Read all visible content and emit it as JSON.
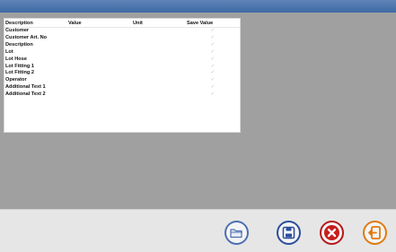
{
  "table": {
    "headers": {
      "description": "Description",
      "value": "Value",
      "unit": "Unit",
      "save_value": "Save Value"
    },
    "rows": [
      {
        "description": "Customer",
        "value": "",
        "unit": "",
        "save_value": "✓"
      },
      {
        "description": "Customer Art. No",
        "value": "",
        "unit": "",
        "save_value": "✓"
      },
      {
        "description": "Description",
        "value": "",
        "unit": "",
        "save_value": "✓"
      },
      {
        "description": "Lot",
        "value": "",
        "unit": "",
        "save_value": "✓"
      },
      {
        "description": "Lot Hose",
        "value": "",
        "unit": "",
        "save_value": "✓"
      },
      {
        "description": "Lot Fitting 1",
        "value": "",
        "unit": "",
        "save_value": "✓"
      },
      {
        "description": "Lot Fitting 2",
        "value": "",
        "unit": "",
        "save_value": "✓"
      },
      {
        "description": "Operator",
        "value": "",
        "unit": "",
        "save_value": "✓"
      },
      {
        "description": "Additional Text 1",
        "value": "",
        "unit": "",
        "save_value": "✓"
      },
      {
        "description": "Additional Text 2",
        "value": "",
        "unit": "",
        "save_value": "✓"
      }
    ]
  },
  "footer": {
    "buttons": [
      {
        "icon": "folder-icon",
        "color": "#4d6fb1"
      },
      {
        "icon": "floppy-disk-icon",
        "color": "#2b4e9d"
      },
      {
        "icon": "close-icon",
        "color": "#b51818"
      },
      {
        "icon": "exit-icon",
        "color": "#e07a10"
      }
    ]
  }
}
